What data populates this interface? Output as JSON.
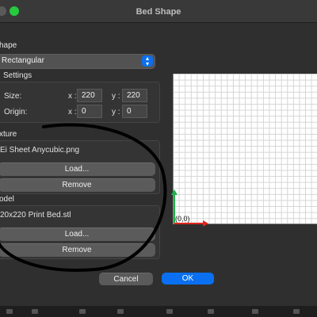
{
  "window": {
    "title": "Bed Shape"
  },
  "shape": {
    "label": "hape",
    "selected": "Rectangular",
    "settings_label": "Settings",
    "size_label": "Size:",
    "origin_label": "Origin:",
    "x_label": "x :",
    "y_label": "y :",
    "size_x": "220",
    "size_y": "220",
    "origin_x": "0",
    "origin_y": "0"
  },
  "texture": {
    "label": "xture",
    "file": "Ei Sheet Anycubic.png",
    "load_label": "Load...",
    "remove_label": "Remove"
  },
  "model": {
    "label": "odel",
    "file": "20x220 Print Bed.stl",
    "load_label": "Load...",
    "remove_label": "Remove"
  },
  "preview": {
    "origin_label": "(0,0)",
    "x_axis_color": "#e0261d",
    "y_axis_color": "#22b14c"
  },
  "dialog": {
    "cancel_label": "Cancel",
    "ok_label": "OK"
  },
  "colors": {
    "accent": "#0a6ff0"
  },
  "icons": {
    "select_chevron": "chevron-up-down-icon"
  }
}
